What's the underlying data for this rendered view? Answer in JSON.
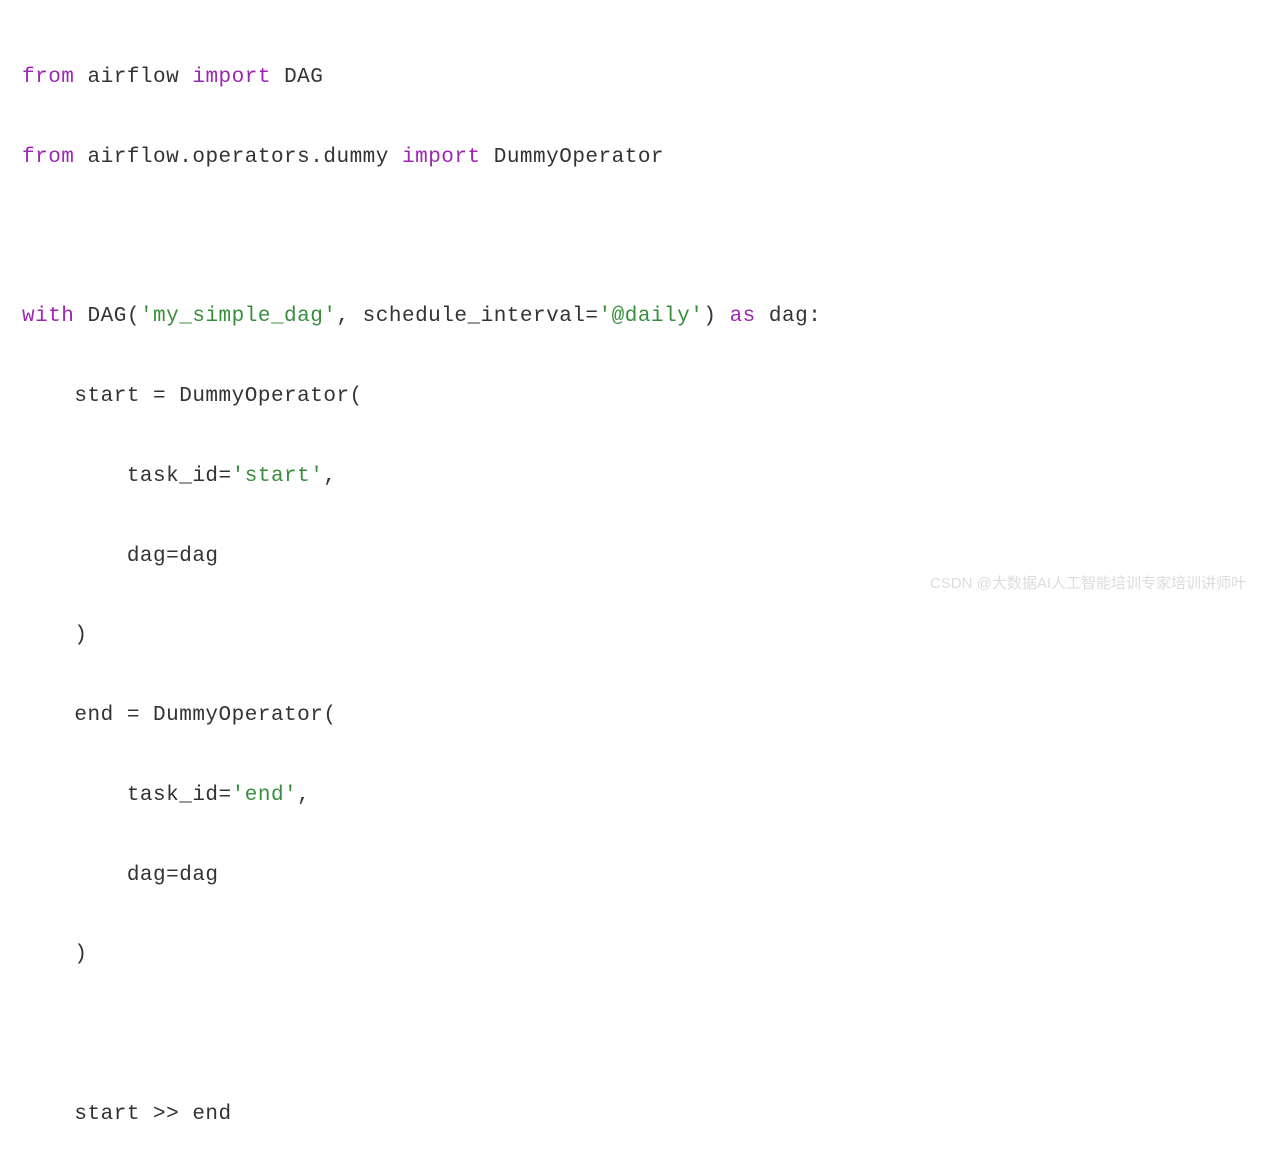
{
  "code": {
    "line1": {
      "kw1": "from",
      "t1": " airflow ",
      "kw2": "import",
      "t2": " DAG"
    },
    "line2": {
      "kw1": "from",
      "t1": " airflow.operators.dummy ",
      "kw2": "import",
      "t2": " DummyOperator"
    },
    "line4": {
      "kw1": "with",
      "t1": " DAG(",
      "s1": "'my_simple_dag'",
      "t2": ", schedule_interval=",
      "s2": "'@daily'",
      "t3": ") ",
      "kw2": "as",
      "t4": " dag:"
    },
    "line5": {
      "t1": "    start = DummyOperator("
    },
    "line6": {
      "t1": "        task_id=",
      "s1": "'start'",
      "t2": ","
    },
    "line7": {
      "t1": "        dag=dag"
    },
    "line8": {
      "t1": "    )"
    },
    "line9": {
      "t1": "    end = DummyOperator("
    },
    "line10": {
      "t1": "        task_id=",
      "s1": "'end'",
      "t2": ","
    },
    "line11": {
      "t1": "        dag=dag"
    },
    "line12": {
      "t1": "    )"
    },
    "line14": {
      "t1": "    start >> end"
    }
  },
  "watermark": "CSDN @大数据AI人工智能培训专家培训讲师叶"
}
